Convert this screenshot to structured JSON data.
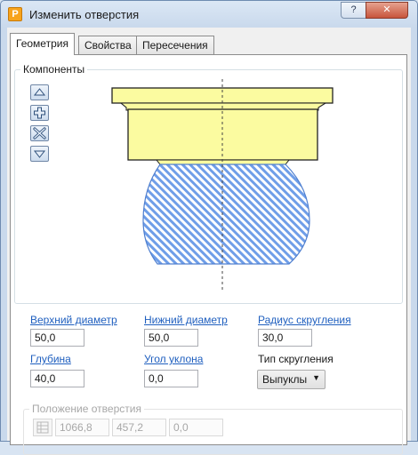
{
  "window": {
    "title": "Изменить отверстия",
    "app_icon_letter": "P",
    "help_label": "?",
    "close_label": "✕"
  },
  "tabs": [
    {
      "label": "Геометрия",
      "active": true
    },
    {
      "label": "Свойства",
      "active": false
    },
    {
      "label": "Пересечения",
      "active": false
    }
  ],
  "components": {
    "legend": "Компоненты",
    "tools": [
      "move-up-icon",
      "add-icon",
      "delete-icon",
      "move-down-icon"
    ]
  },
  "fields": {
    "top_diameter": {
      "label": "Верхний диаметр",
      "value": "50,0"
    },
    "bottom_diameter": {
      "label": "Нижний диаметр",
      "value": "50,0"
    },
    "fillet_radius": {
      "label": "Радиус скругления",
      "value": "30,0"
    },
    "depth": {
      "label": "Глубина",
      "value": "40,0"
    },
    "draft_angle": {
      "label": "Угол уклона",
      "value": "0,0"
    },
    "fillet_type": {
      "label": "Тип скругления",
      "value": "Выпуклы"
    }
  },
  "position": {
    "legend": "Положение отверстия",
    "x": "1066,8",
    "y": "457,2",
    "z": "0,0"
  },
  "colors": {
    "accent_link": "#1f5fbf",
    "component_fill": "#fbfba0",
    "hatch_fill": "#6f9ee8"
  }
}
